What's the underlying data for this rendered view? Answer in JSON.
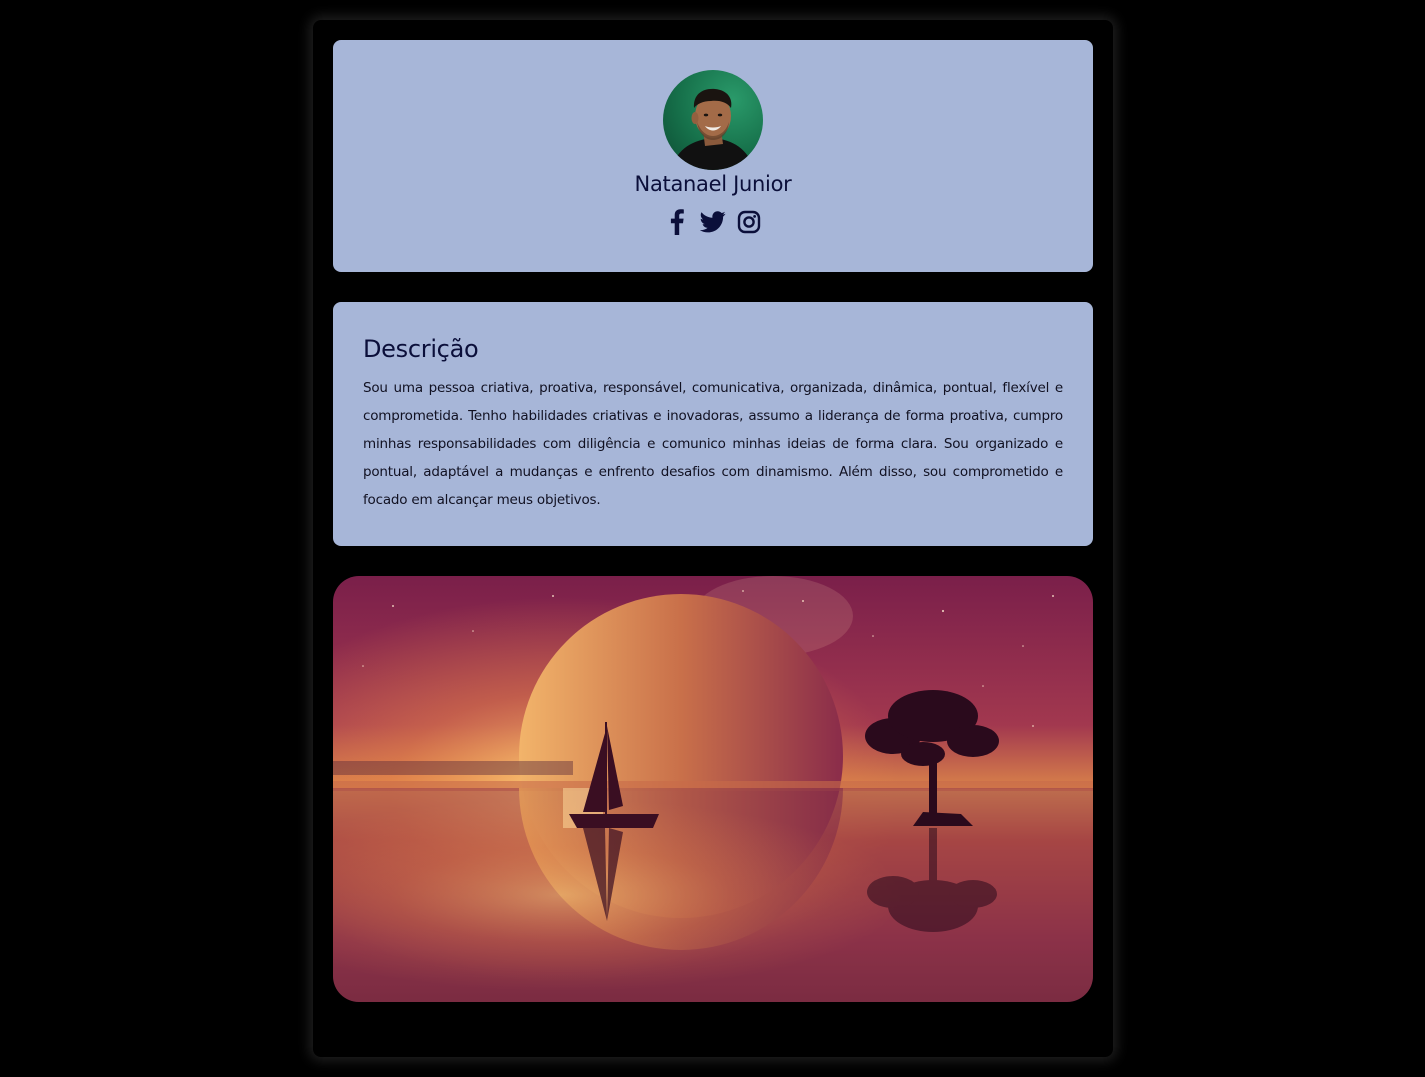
{
  "profile": {
    "name": "Natanael Junior",
    "avatar_alt": "Foto de perfil",
    "socials": [
      {
        "name": "facebook",
        "icon": "facebook-icon"
      },
      {
        "name": "twitter",
        "icon": "twitter-icon"
      },
      {
        "name": "instagram",
        "icon": "instagram-icon"
      }
    ]
  },
  "description": {
    "title": "Descrição",
    "text": "Sou uma pessoa criativa, proativa, responsável, comunicativa, organizada, dinâmica, pontual, flexível e comprometida. Tenho habilidades criativas e inovadoras, assumo a liderança de forma proativa, cumpro minhas responsabilidades com diligência e comunico minhas ideias de forma clara. Sou organizado e pontual, adaptável a mudanças e enfrento desafios com dinamismo. Além disso, sou comprometido e focado em alcançar meus objetivos."
  },
  "hero": {
    "image": "moon-sea-sailboat-tree-landscape"
  },
  "colors": {
    "page_background": "#000000",
    "card_background": "#a7b6d8",
    "text_dark": "#0b0f3a"
  }
}
